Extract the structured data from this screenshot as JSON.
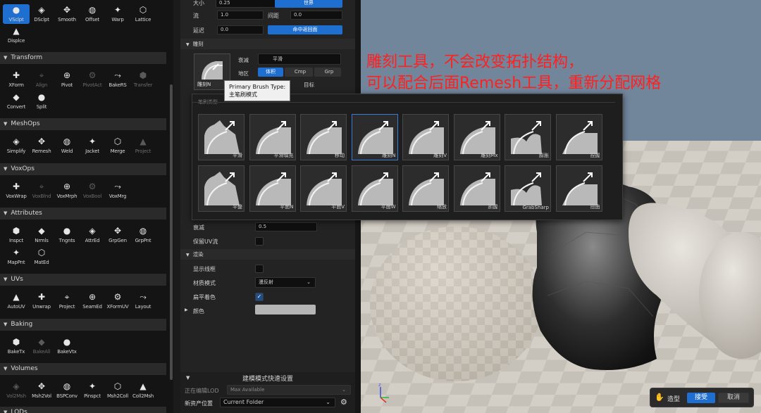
{
  "annotation": {
    "line1": "雕刻工具，不会改变拓扑结构，",
    "line2": "可以配合后面Remesh工具，重新分配网格"
  },
  "top_tools": [
    {
      "label": "VSclpt",
      "icon": "vsculpt-icon",
      "sel": true
    },
    {
      "label": "DSclpt",
      "icon": "dsculpt-icon"
    },
    {
      "label": "Smooth",
      "icon": "smooth-icon"
    },
    {
      "label": "Offset",
      "icon": "offset-icon"
    },
    {
      "label": "Warp",
      "icon": "warp-icon"
    },
    {
      "label": "Lattice",
      "icon": "lattice-icon"
    },
    {
      "label": "Displce",
      "icon": "displace-icon"
    }
  ],
  "sections": [
    {
      "title": "Transform",
      "tools": [
        {
          "label": "XForm"
        },
        {
          "label": "Align",
          "dim": true
        },
        {
          "label": "Pivot"
        },
        {
          "label": "PivotAct",
          "dim": true
        },
        {
          "label": "BakeRS"
        },
        {
          "label": "Transfer",
          "dim": true
        },
        {
          "label": "Convert"
        },
        {
          "label": "Split"
        }
      ]
    },
    {
      "title": "MeshOps",
      "tools": [
        {
          "label": "Simplify"
        },
        {
          "label": "Remesh"
        },
        {
          "label": "Weld"
        },
        {
          "label": "Jacket"
        },
        {
          "label": "Merge"
        },
        {
          "label": "Project",
          "dim": true
        }
      ]
    },
    {
      "title": "VoxOps",
      "tools": [
        {
          "label": "VoxWrap"
        },
        {
          "label": "VoxBlnd",
          "dim": true
        },
        {
          "label": "VoxMrph"
        },
        {
          "label": "VoxBool",
          "dim": true
        },
        {
          "label": "VoxMrg"
        }
      ]
    },
    {
      "title": "Attributes",
      "tools": [
        {
          "label": "Inspct"
        },
        {
          "label": "Nrmls"
        },
        {
          "label": "Tngnts"
        },
        {
          "label": "AttrEd"
        },
        {
          "label": "GrpGen"
        },
        {
          "label": "GrpPnt"
        },
        {
          "label": "MapPnt"
        },
        {
          "label": "MatEd"
        }
      ]
    },
    {
      "title": "UVs",
      "tools": [
        {
          "label": "AutoUV"
        },
        {
          "label": "Unwrap"
        },
        {
          "label": "Project"
        },
        {
          "label": "SeamEd"
        },
        {
          "label": "XFormUV"
        },
        {
          "label": "Layout"
        }
      ]
    },
    {
      "title": "Baking",
      "tools": [
        {
          "label": "BakeTx"
        },
        {
          "label": "BakeAll",
          "dim": true
        },
        {
          "label": "BakeVtx"
        }
      ]
    },
    {
      "title": "Volumes",
      "tools": [
        {
          "label": "Vol2Msh",
          "dim": true
        },
        {
          "label": "Msh2Vol"
        },
        {
          "label": "BSPConv"
        },
        {
          "label": "Pinspct"
        },
        {
          "label": "Msh2Coll"
        },
        {
          "label": "Coll2Msh"
        }
      ]
    },
    {
      "title": "LODs",
      "tools": []
    }
  ],
  "details": {
    "size_label": "大小",
    "size_value": "0.25",
    "world_btn": "世界",
    "flow_label": "流",
    "flow_value": "1.0",
    "spacing_label": "间距",
    "spacing_value": "0.0",
    "lag_label": "延迟",
    "lag_value": "0.0",
    "hit_back_btn": "命中返回面",
    "sculpt_header": "雕刻",
    "falloff_label": "衰减",
    "falloff_value": "平滑",
    "region_label": "地区",
    "region_opts": [
      "体积",
      "Cmp",
      "Grp"
    ],
    "target_label": "目标",
    "brush_thumb_label": "雕刻N",
    "falloff2_label": "衰减",
    "falloff2_value": "0.5",
    "keep_uv_label": "保留UV流",
    "render_header": "渲染",
    "show_wire_label": "显示线框",
    "material_label": "材质模式",
    "material_value": "漫反射",
    "flat_shade_label": "扁平着色",
    "color_label": "颜色"
  },
  "popup": {
    "header": "笔刷类型",
    "brushes": [
      "平滑",
      "平滑填充",
      "移动",
      "雕刻N",
      "雕刻V",
      "雕刻Mx",
      "膨胀",
      "捏握",
      "平整",
      "平面N",
      "平面V",
      "平面W",
      "缩放",
      "抓握",
      "GrabSharp",
      "扭曲"
    ]
  },
  "tooltip": {
    "line1": "Primary Brush Type:",
    "line2": "主笔刷模式"
  },
  "quick": {
    "title": "建模模式快速设置",
    "lod_label": "正在编辑LOD",
    "lod_value": "Max Available",
    "asset_label": "新资产位置",
    "asset_value": "Current Folder"
  },
  "bottombar": {
    "mode": "造型",
    "accept": "接受",
    "cancel": "取消"
  }
}
